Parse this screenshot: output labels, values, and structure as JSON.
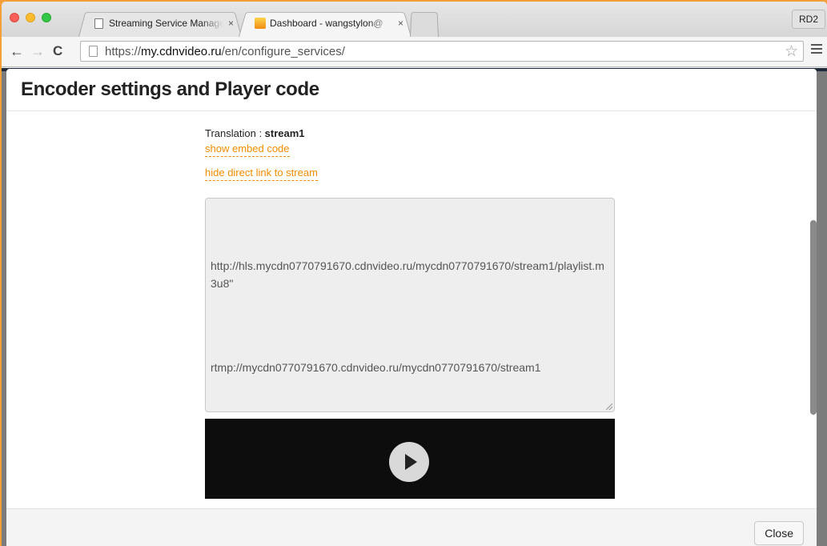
{
  "browser": {
    "tabs": [
      {
        "title": "Streaming Service Manage",
        "close": "×",
        "active": false
      },
      {
        "title": "Dashboard - wangstylon@",
        "close": "×",
        "active": true
      }
    ],
    "profile_label": "RD2",
    "back": "←",
    "forward": "→",
    "reload": "C",
    "url_scheme": "https://",
    "url_host": "my.cdnvideo.ru",
    "url_path": "/en/configure_services/",
    "star": "☆"
  },
  "modal": {
    "title": "Encoder settings and Player code",
    "translation_label": "Translation : ",
    "translation_value": "stream1",
    "show_embed_link": "show embed code",
    "hide_direct_link": "hide direct link to stream",
    "hls_url": "http://hls.mycdn0770791670.cdnvideo.ru/mycdn0770791670/stream1/playlist.m3u8\"",
    "rtmp_url": "rtmp://mycdn0770791670.cdnvideo.ru/mycdn0770791670/stream1",
    "close_label": "Close"
  },
  "colors": {
    "link": "#f08c00",
    "player_bg": "#0d0d0d"
  }
}
